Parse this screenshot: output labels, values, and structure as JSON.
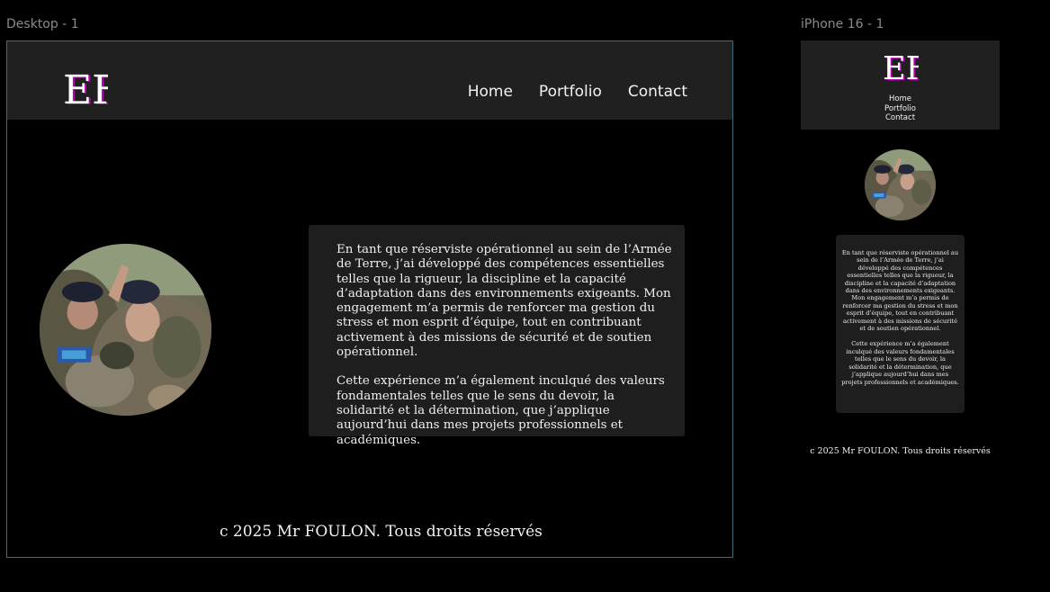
{
  "frames": {
    "desktop_label": "Desktop - 1",
    "mobile_label": "iPhone 16 - 1"
  },
  "site": {
    "logo_text": "EF",
    "nav": [
      {
        "label": "Home"
      },
      {
        "label": "Portfolio"
      },
      {
        "label": "Contact"
      }
    ],
    "about_paragraphs": [
      "En tant que réserviste opérationnel au sein de  l’Armée de Terre, j’ai développé des compétences essentielles telles que la rigueur, la discipline et la capacité d’adaptation dans des  environnements exigeants. Mon engagement m’a permis de renforcer ma  gestion du stress et mon esprit d’équipe, tout en contribuant activement à des missions de sécurité et de soutien opérationnel.",
      "Cette  expérience m’a également inculqué des valeurs fondamentales telles que  le sens du devoir, la solidarité et la détermination, que j’applique  aujourd’hui dans mes projets professionnels et académiques."
    ],
    "footer": "c 2025 Mr FOULON. Tous droits réservés",
    "avatar_description_icon": "soldier-photo"
  },
  "colors": {
    "canvas": "#000000",
    "header": "#202020",
    "textbox": "#1e1e1e",
    "frame_border": "#3d6d7a",
    "logo_accent": "#d400d4"
  }
}
